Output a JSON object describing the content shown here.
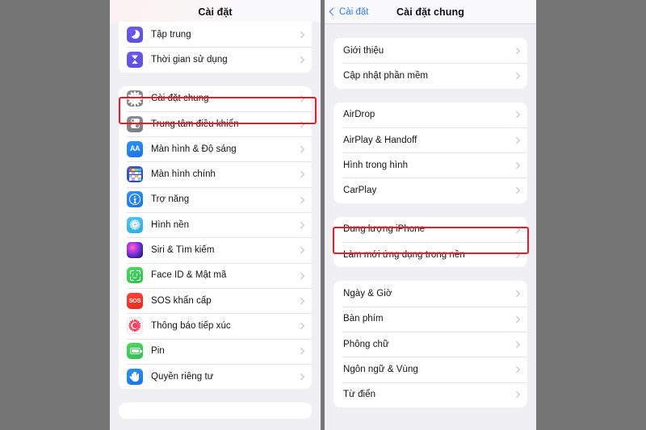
{
  "theme": {
    "page_background": "#757575",
    "panel_background": "#efeff4",
    "card_background": "#ffffff",
    "highlight_color": "#ed1c24",
    "accent_blue": "#2f7bf6"
  },
  "left_panel": {
    "navbar": {
      "title": "Cài đặt"
    },
    "groups": [
      {
        "clipped_top": true,
        "rows": [
          {
            "label": "Tập trung",
            "icon": "focus-moon-icon",
            "icon_class": "ic-focus"
          },
          {
            "label": "Thời gian sử dụng",
            "icon": "screen-time-hourglass-icon",
            "icon_class": "ic-screentime"
          }
        ]
      },
      {
        "clipped_top": false,
        "rows": [
          {
            "label": "Cài đặt chung",
            "icon": "gear-icon",
            "icon_class": "ic-general",
            "highlighted": true
          },
          {
            "label": "Trung tâm điều khiển",
            "icon": "control-center-icon",
            "icon_class": "ic-control"
          },
          {
            "label": "Màn hình & Độ sáng",
            "icon": "display-brightness-icon",
            "icon_class": "ic-display"
          },
          {
            "label": "Màn hình chính",
            "icon": "home-screen-grid-icon",
            "icon_class": "ic-home"
          },
          {
            "label": "Trợ năng",
            "icon": "accessibility-icon",
            "icon_class": "ic-access"
          },
          {
            "label": "Hình nền",
            "icon": "wallpaper-flower-icon",
            "icon_class": "ic-wallpaper"
          },
          {
            "label": "Siri & Tìm kiếm",
            "icon": "siri-orb-icon",
            "icon_class": "ic-siri"
          },
          {
            "label": "Face ID & Mật mã",
            "icon": "face-id-icon",
            "icon_class": "ic-faceid"
          },
          {
            "label": "SOS khẩn cấp",
            "icon": "sos-icon",
            "icon_class": "ic-sos"
          },
          {
            "label": "Thông báo tiếp xúc",
            "icon": "exposure-notification-icon",
            "icon_class": "ic-exposure"
          },
          {
            "label": "Pin",
            "icon": "battery-icon",
            "icon_class": "ic-battery"
          },
          {
            "label": "Quyền riêng tư",
            "icon": "privacy-hand-icon",
            "icon_class": "ic-privacy"
          }
        ]
      }
    ]
  },
  "right_panel": {
    "navbar": {
      "back_label": "Cài đặt",
      "title": "Cài đặt chung"
    },
    "groups": [
      {
        "rows": [
          {
            "label": "Giới thiệu"
          },
          {
            "label": "Cập nhật phần mềm"
          }
        ]
      },
      {
        "rows": [
          {
            "label": "AirDrop"
          },
          {
            "label": "AirPlay & Handoff"
          },
          {
            "label": "Hình trong hình"
          },
          {
            "label": "CarPlay"
          }
        ]
      },
      {
        "rows": [
          {
            "label": "Dung lượng iPhone",
            "highlighted": true
          },
          {
            "label": "Làm mới ứng dụng trong nền"
          }
        ]
      },
      {
        "rows": [
          {
            "label": "Ngày & Giờ"
          },
          {
            "label": "Bàn phím"
          },
          {
            "label": "Phông chữ"
          },
          {
            "label": "Ngôn ngữ & Vùng"
          },
          {
            "label": "Từ điển"
          }
        ]
      }
    ]
  },
  "annotations": [
    {
      "name": "highlight-general-row",
      "target": "Cài đặt chung"
    },
    {
      "name": "highlight-storage-row",
      "target": "Dung lượng iPhone"
    }
  ]
}
